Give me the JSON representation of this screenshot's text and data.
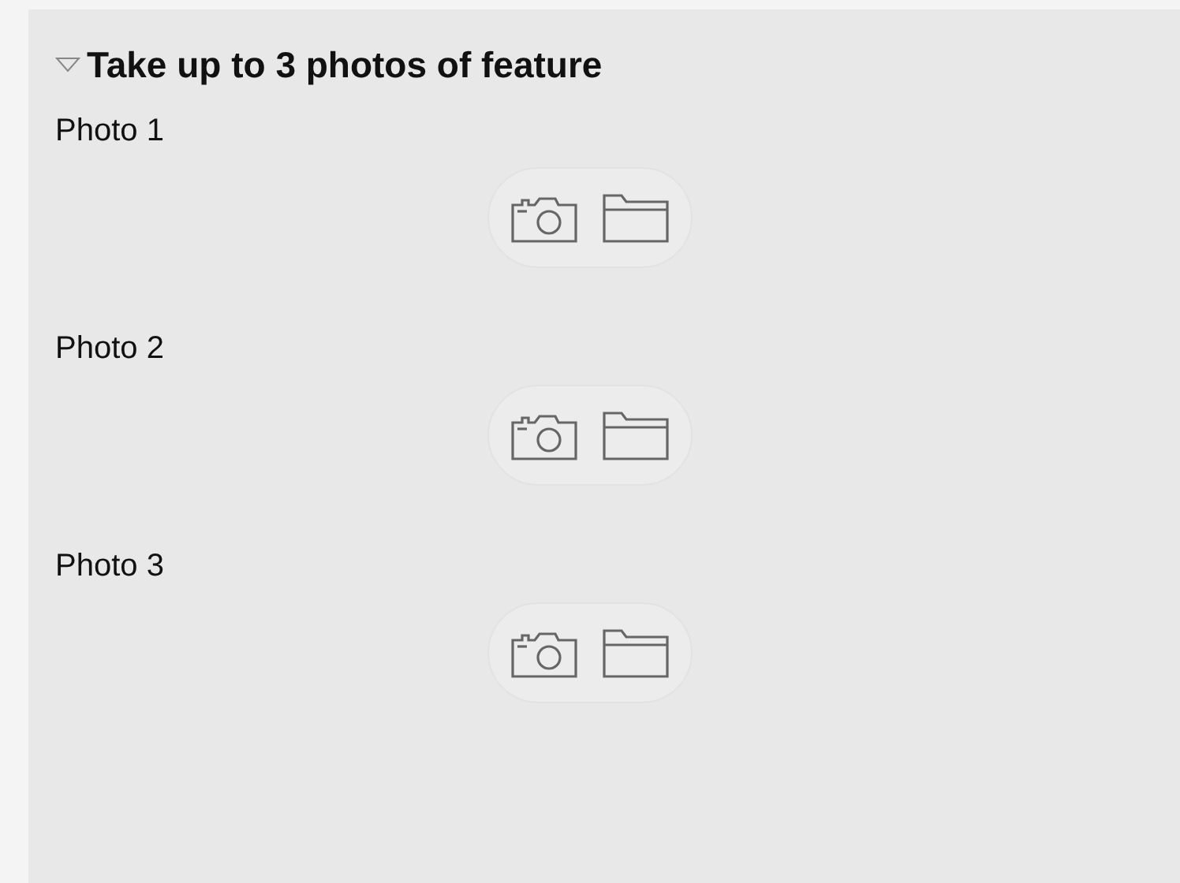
{
  "section": {
    "title": "Take up to 3 photos of feature",
    "expanded": true,
    "photos": [
      {
        "label": "Photo 1"
      },
      {
        "label": "Photo 2"
      },
      {
        "label": "Photo 3"
      }
    ]
  }
}
